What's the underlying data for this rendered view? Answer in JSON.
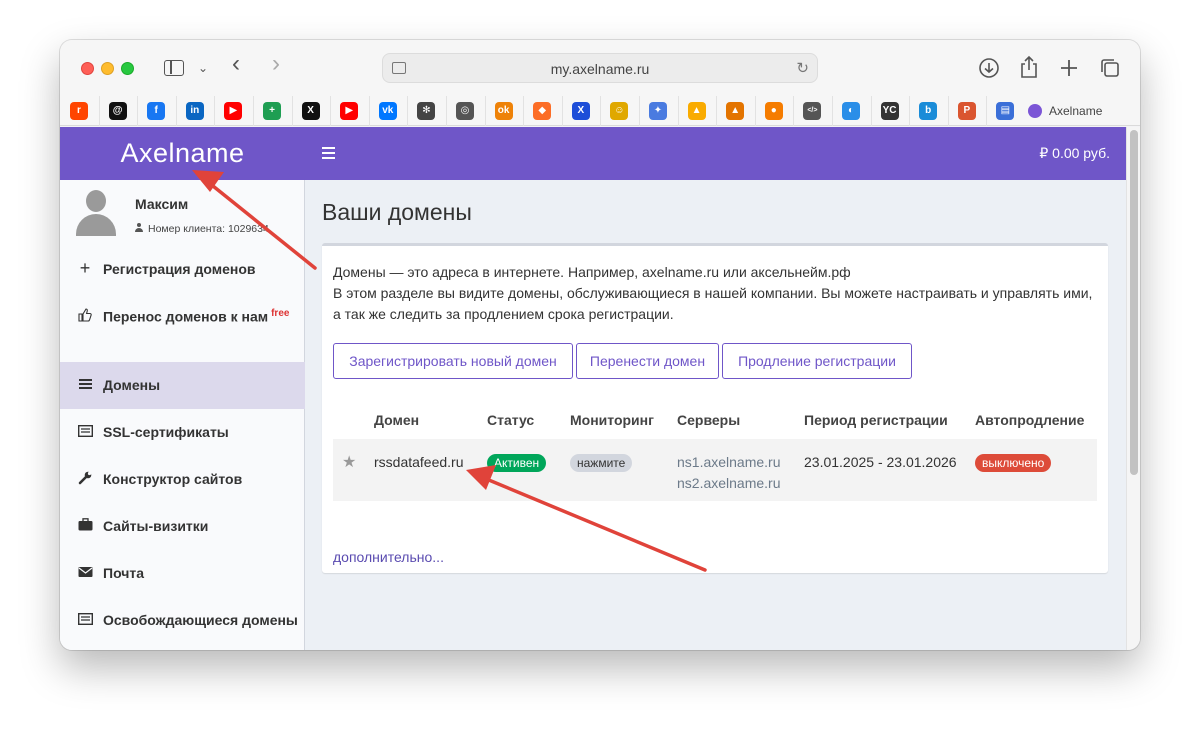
{
  "browser": {
    "url": "my.axelname.ru",
    "tab_title": "Axelname",
    "favorites": [
      {
        "icon": "reddit-icon",
        "color": "#ff4500",
        "glyph": "r"
      },
      {
        "icon": "threads-icon",
        "color": "#111111",
        "glyph": "@"
      },
      {
        "icon": "facebook-icon",
        "color": "#1877f2",
        "glyph": "f"
      },
      {
        "icon": "linkedin-icon",
        "color": "#0a66c2",
        "glyph": "in"
      },
      {
        "icon": "youtube-icon",
        "color": "#ff0000",
        "glyph": "▶"
      },
      {
        "icon": "sheets-icon",
        "color": "#1e9e52",
        "glyph": "+"
      },
      {
        "icon": "x-icon",
        "color": "#111111",
        "glyph": "X"
      },
      {
        "icon": "youtube-icon",
        "color": "#ff0000",
        "glyph": "▶"
      },
      {
        "icon": "vk-icon",
        "color": "#0077ff",
        "glyph": "vk"
      },
      {
        "icon": "openai-icon",
        "color": "#444444",
        "glyph": "✻"
      },
      {
        "icon": "compass-icon",
        "color": "#555555",
        "glyph": "◎"
      },
      {
        "icon": "odnoklassniki-icon",
        "color": "#ee8208",
        "glyph": "ok"
      },
      {
        "icon": "gitlab-icon",
        "color": "#fc6d26",
        "glyph": "◆"
      },
      {
        "icon": "x-bookmark-icon",
        "color": "#1d4ed8",
        "glyph": "X"
      },
      {
        "icon": "emoji-icon",
        "color": "#e0a800",
        "glyph": "☺"
      },
      {
        "icon": "gemini-icon",
        "color": "#4a7be0",
        "glyph": "✦"
      },
      {
        "icon": "analytics-icon",
        "color": "#f9ab00",
        "glyph": "▲"
      },
      {
        "icon": "analytics-icon",
        "color": "#e37400",
        "glyph": "▲"
      },
      {
        "icon": "orange-circle-icon",
        "color": "#f57c00",
        "glyph": "●"
      },
      {
        "icon": "code-icon",
        "color": "#555555",
        "glyph": "</>"
      },
      {
        "icon": "edge-icon",
        "color": "#2a8ee8",
        "glyph": "◐"
      },
      {
        "icon": "yc-icon",
        "color": "#333333",
        "glyph": "YC"
      },
      {
        "icon": "bing-icon",
        "color": "#1a8cd8",
        "glyph": "b"
      },
      {
        "icon": "producthunt-icon",
        "color": "#da552f",
        "glyph": "P"
      },
      {
        "icon": "docs-icon",
        "color": "#3b6fd8",
        "glyph": "▤"
      }
    ]
  },
  "header": {
    "logo": "Axelname",
    "balance": "₽ 0.00 руб."
  },
  "user": {
    "name": "Максим",
    "client_label": "Номер клиента: 1029634"
  },
  "sidebar": {
    "items": [
      {
        "icon": "plus-icon",
        "glyph": "+",
        "label": "Регистрация доменов",
        "sup": ""
      },
      {
        "icon": "thumbs-up-icon",
        "glyph": "👍",
        "label": "Перенос доменов к нам",
        "sup": "free"
      },
      {
        "icon": "list-icon",
        "glyph": "≡",
        "label": "Домены",
        "sup": ""
      },
      {
        "icon": "certificate-icon",
        "glyph": "▤",
        "label": "SSL-сертификаты",
        "sup": ""
      },
      {
        "icon": "wrench-icon",
        "glyph": "🔧",
        "label": "Конструктор сайтов",
        "sup": ""
      },
      {
        "icon": "briefcase-icon",
        "glyph": "💼",
        "label": "Сайты-визитки",
        "sup": ""
      },
      {
        "icon": "mail-icon",
        "glyph": "✉",
        "label": "Почта",
        "sup": ""
      },
      {
        "icon": "table-icon",
        "glyph": "▤",
        "label": "Освобождающиеся домены",
        "sup": ""
      }
    ]
  },
  "main": {
    "title": "Ваши домены",
    "intro_line1": "Домены — это адреса в интернете. Например, axelname.ru или аксельнейм.рф",
    "intro_line2": "В этом разделе вы видите домены, обслуживающиеся в нашей компании. Вы можете настраивать и управлять ими,",
    "intro_line3": "а так же следить за продлением срока регистрации.",
    "buttons": {
      "register": "Зарегистрировать новый домен",
      "transfer": "Перенести домен",
      "renew": "Продление регистрации"
    },
    "table": {
      "headers": {
        "domain": "Домен",
        "status": "Статус",
        "monitoring": "Мониторинг",
        "servers": "Серверы",
        "period": "Период регистрации",
        "autorenew": "Автопродление"
      },
      "rows": [
        {
          "domain": "rssdatafeed.ru",
          "status": "Активен",
          "monitoring": "нажмите",
          "ns1": "ns1.axelname.ru",
          "ns2": "ns2.axelname.ru",
          "period": "23.01.2025 - 23.01.2026",
          "autorenew": "выключено"
        }
      ]
    },
    "more_link": "дополнительно..."
  },
  "colors": {
    "brand": "#6f56c8",
    "active_badge": "#00a65a",
    "off_badge": "#dd4b39",
    "annotation_arrow": "#e0433a"
  }
}
